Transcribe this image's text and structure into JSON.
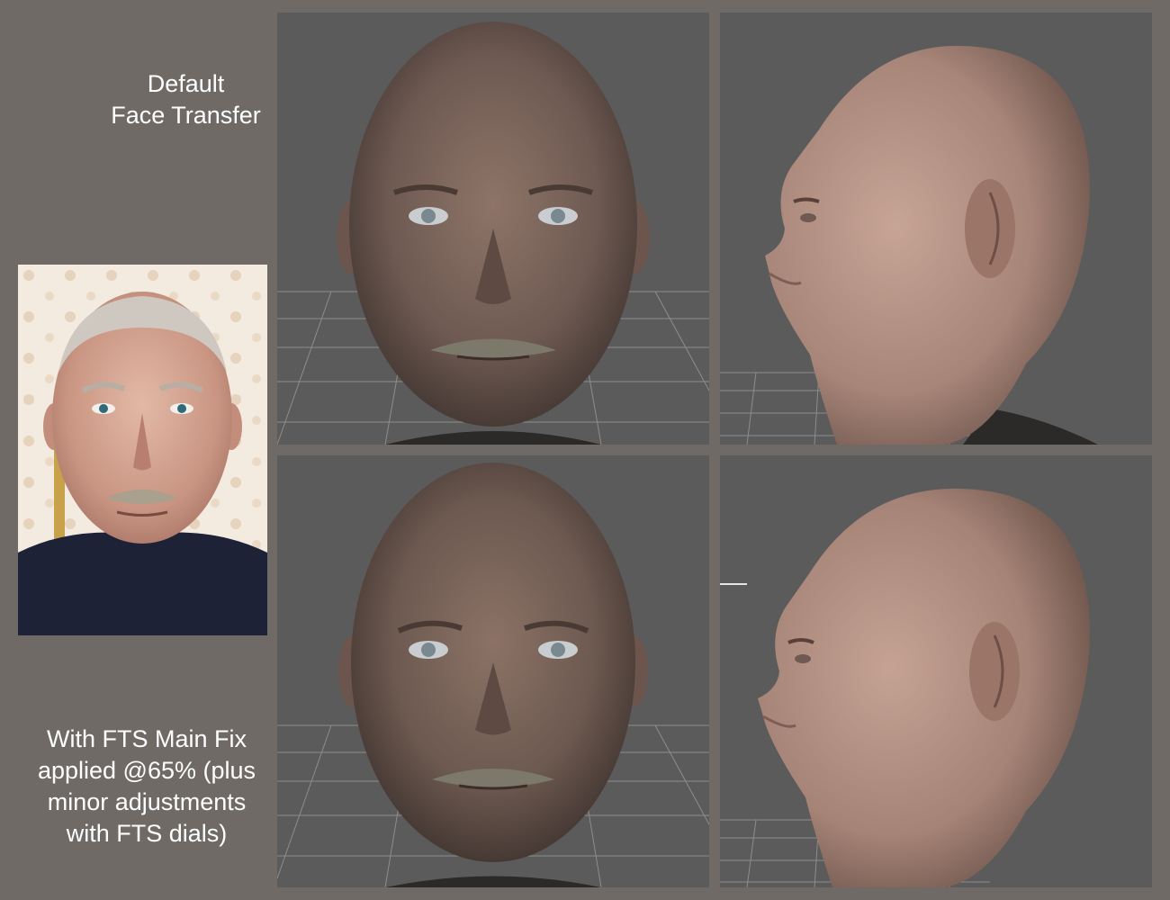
{
  "captions": {
    "top": {
      "line1": "Default",
      "line2": "Face Transfer"
    },
    "bottom": {
      "line1": "With FTS Main Fix",
      "line2": "applied @65% (plus",
      "line3": "minor adjustments",
      "line4": "with FTS dials)"
    }
  },
  "colors": {
    "background": "#6f6a66",
    "viewport": "#5b5b5b",
    "grid": "#9a9a9a",
    "skin_front": "#9a7f72",
    "skin_side": "#bf9a8c",
    "caption_text": "#ffffff"
  }
}
